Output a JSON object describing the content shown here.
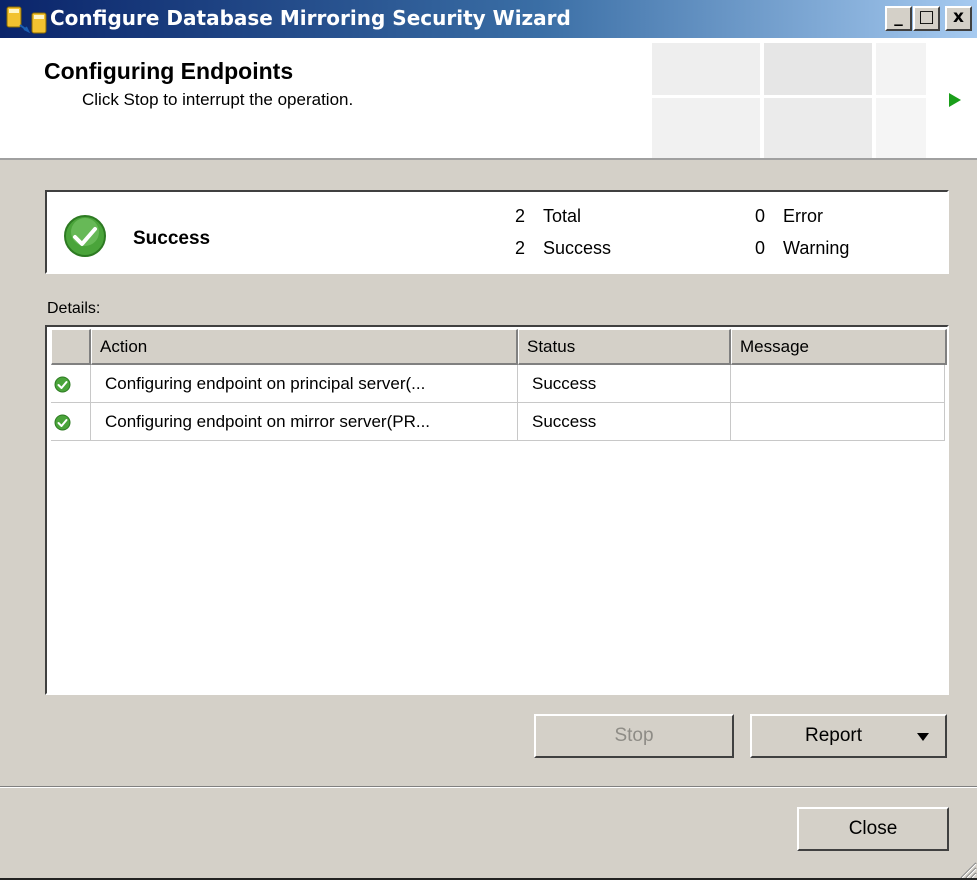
{
  "window": {
    "title": "Configure Database Mirroring Security Wizard",
    "controls": {
      "minimize": "_",
      "maximize": "□",
      "close": "x"
    }
  },
  "header": {
    "title": "Configuring Endpoints",
    "subtitle": "Click Stop to interrupt the operation."
  },
  "summary": {
    "status": "Success",
    "total_count": "2",
    "total_label": "Total",
    "success_count": "2",
    "success_label": "Success",
    "error_count": "0",
    "error_label": "Error",
    "warning_count": "0",
    "warning_label": "Warning"
  },
  "details": {
    "label": "Details:",
    "columns": [
      "Action",
      "Status",
      "Message"
    ],
    "rows": [
      {
        "action": "Configuring endpoint on principal server(...",
        "status": "Success",
        "message": ""
      },
      {
        "action": "Configuring endpoint on mirror server(PR...",
        "status": "Success",
        "message": ""
      }
    ]
  },
  "buttons": {
    "stop": "Stop",
    "report": "Report",
    "close": "Close"
  },
  "icons": {
    "app": "database-mirroring-icon",
    "status": "success-check-icon",
    "header_decoration": "play-arrow-icon"
  },
  "colors": {
    "titlebar_start": "#0a246a",
    "titlebar_end": "#a6caf0",
    "success_green": "#4aa43a",
    "dialog_face": "#d4d0c8"
  }
}
